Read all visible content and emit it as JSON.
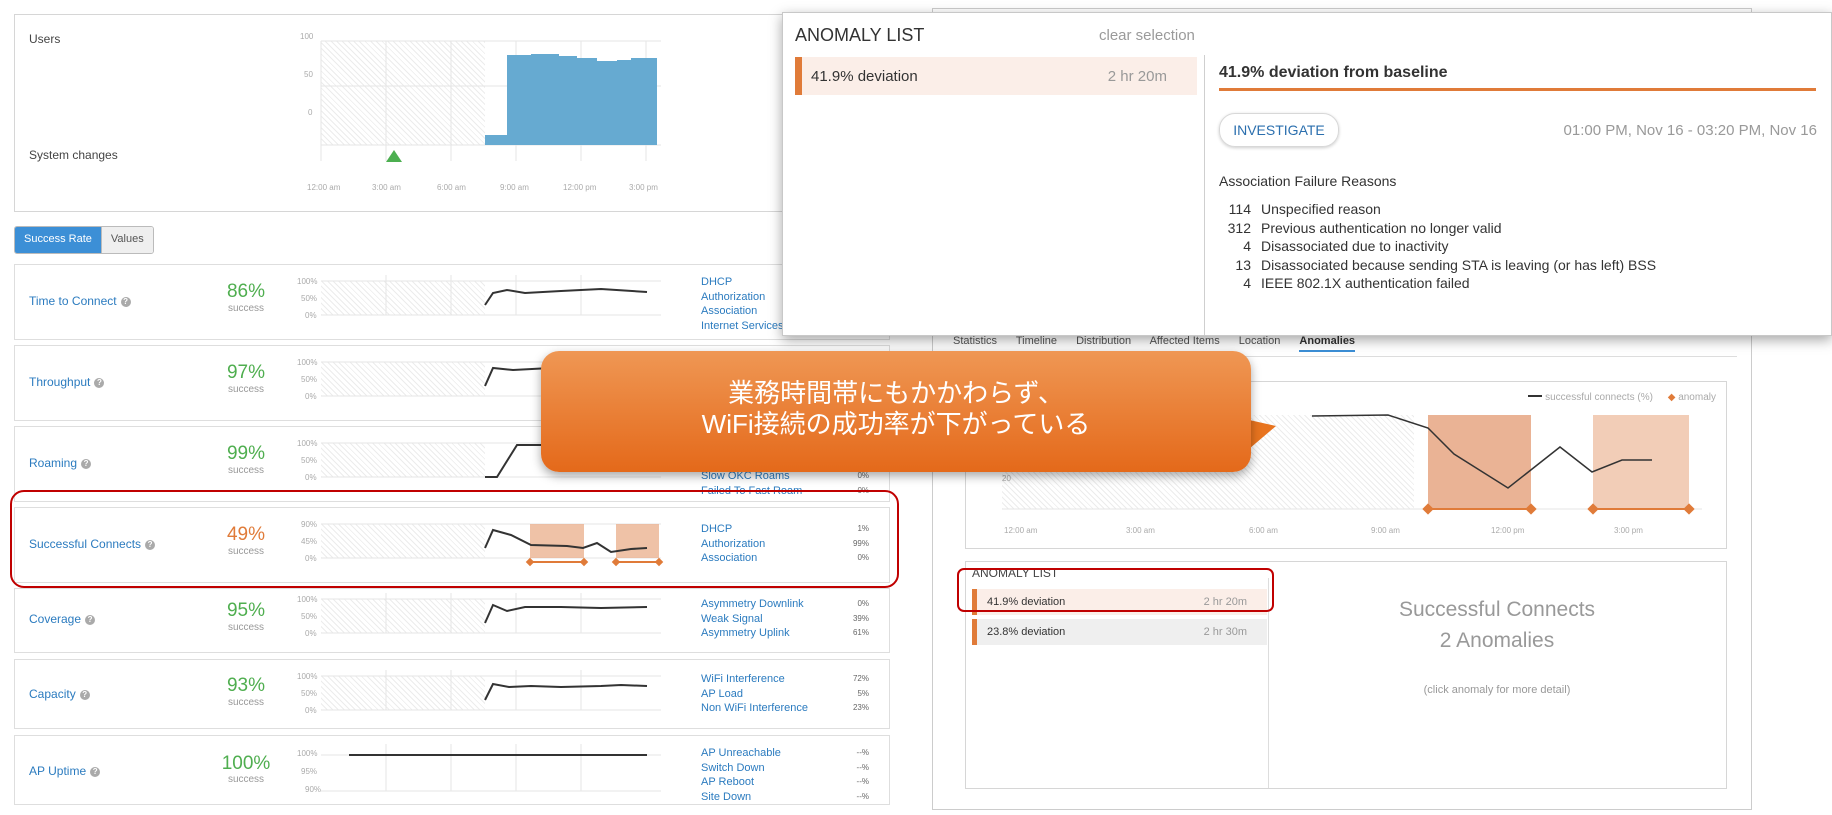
{
  "top_chart": {
    "users_label": "Users",
    "system_changes_label": "System changes",
    "y_ticks": [
      "100",
      "50",
      "0"
    ],
    "x_ticks": [
      "12:00 am",
      "3:00 am",
      "6:00 am",
      "9:00 am",
      "12:00 pm",
      "3:00 pm"
    ],
    "bar_color": "#66aad1"
  },
  "toggle": {
    "success_rate": "Success Rate",
    "values": "Values"
  },
  "metrics": [
    {
      "name": "Time to Connect",
      "pct": "86%",
      "sub": "success",
      "color": "#4fae4f",
      "y_ticks": [
        "100%",
        "50%",
        "0%"
      ],
      "reasons": [
        "DHCP",
        "Authorization",
        "Association",
        "Internet Services"
      ],
      "reason_values": []
    },
    {
      "name": "Throughput",
      "pct": "97%",
      "sub": "success",
      "color": "#4fae4f",
      "y_ticks": [
        "100%",
        "50%",
        "0%"
      ],
      "reasons": [],
      "reason_values": []
    },
    {
      "name": "Roaming",
      "pct": "99%",
      "sub": "success",
      "color": "#4fae4f",
      "y_ticks": [
        "100%",
        "50%",
        "0%"
      ],
      "reasons": [
        "Slow OKC Roams",
        "Failed To Fast Roam"
      ],
      "reason_values": [
        "0%",
        "0%"
      ]
    },
    {
      "name": "Successful Connects",
      "pct": "49%",
      "sub": "success",
      "color": "#e07b39",
      "y_ticks": [
        "90%",
        "45%",
        "0%"
      ],
      "reasons": [
        "DHCP",
        "Authorization",
        "Association"
      ],
      "reason_values": [
        "1%",
        "99%",
        "0%"
      ]
    },
    {
      "name": "Coverage",
      "pct": "95%",
      "sub": "success",
      "color": "#4fae4f",
      "y_ticks": [
        "100%",
        "50%",
        "0%"
      ],
      "reasons": [
        "Asymmetry Downlink",
        "Weak Signal",
        "Asymmetry Uplink"
      ],
      "reason_values": [
        "0%",
        "39%",
        "61%"
      ]
    },
    {
      "name": "Capacity",
      "pct": "93%",
      "sub": "success",
      "color": "#4fae4f",
      "y_ticks": [
        "100%",
        "50%",
        "0%"
      ],
      "reasons": [
        "WiFi Interference",
        "AP Load",
        "Non WiFi Interference"
      ],
      "reason_values": [
        "72%",
        "5%",
        "23%"
      ]
    },
    {
      "name": "AP Uptime",
      "pct": "100%",
      "sub": "success",
      "color": "#4fae4f",
      "y_ticks": [
        "100%",
        "95%",
        "90%"
      ],
      "reasons": [
        "AP Unreachable",
        "Switch Down",
        "AP Reboot",
        "Site Down"
      ],
      "reason_values": [
        "--%",
        "--%",
        "--%",
        "--%"
      ]
    }
  ],
  "detail": {
    "tabs": [
      "Statistics",
      "Timeline",
      "Distribution",
      "Affected Items",
      "Location",
      "Anomalies"
    ],
    "active_tab": "Anomalies",
    "legend_series": "successful connects (%)",
    "legend_anomaly": "anomaly",
    "y_tick": "20",
    "x_ticks": [
      "12:00 am",
      "3:00 am",
      "6:00 am",
      "9:00 am",
      "12:00 pm",
      "3:00 pm"
    ],
    "anomaly_list_title": "ANOMALY LIST",
    "anomalies": [
      {
        "label": "41.9% deviation",
        "duration": "2 hr 20m"
      },
      {
        "label": "23.8% deviation",
        "duration": "2 hr 30m"
      }
    ],
    "summary_line1": "Successful Connects",
    "summary_line2": "2 Anomalies",
    "summary_hint": "(click anomaly for more detail)"
  },
  "popup": {
    "title": "ANOMALY LIST",
    "clear": "clear selection",
    "item_label": "41.9% deviation",
    "item_duration": "2 hr 20m",
    "heading": "41.9% deviation from baseline",
    "investigate": "INVESTIGATE",
    "range": "01:00 PM, Nov 16 - 03:20 PM, Nov 16",
    "section": "Association Failure Reasons",
    "reasons": [
      {
        "count": "114",
        "text": "Unspecified reason"
      },
      {
        "count": "312",
        "text": "Previous authentication no longer valid"
      },
      {
        "count": "4",
        "text": "Disassociated due to inactivity"
      },
      {
        "count": "13",
        "text": "Disassociated because sending STA is leaving (or has left) BSS"
      },
      {
        "count": "4",
        "text": "IEEE 802.1X authentication failed"
      }
    ]
  },
  "callout": {
    "line1": "業務時間帯にもかかわらず、",
    "line2": "WiFi接続の成功率が下がっている"
  },
  "colors": {
    "accent_orange": "#e07b39",
    "link_blue": "#2b7bbf",
    "highlight_red": "#c00000"
  }
}
